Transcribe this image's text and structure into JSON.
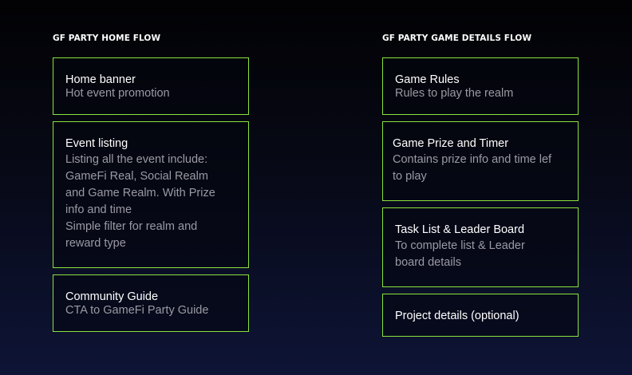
{
  "home_flow": {
    "title": "GF PARTY HOME FLOW",
    "cards": [
      {
        "title": "Home banner",
        "desc": "Hot event promotion"
      },
      {
        "title": "Event listing",
        "desc": "Listing all the event include:\nGameFi Real, Social Realm\nand Game Realm. With Prize\ninfo and time\nSimple filter for realm and\nreward type"
      },
      {
        "title": "Community Guide",
        "desc": "CTA to GameFi Party Guide"
      }
    ]
  },
  "game_details_flow": {
    "title": "GF PARTY GAME DETAILS FLOW",
    "cards": [
      {
        "title": "Game Rules",
        "desc": "Rules to play the realm"
      },
      {
        "title": "Game Prize and Timer",
        "desc": "Contains prize info and time lef\nto play"
      },
      {
        "title": "Task List & Leader Board",
        "desc": "To complete list & Leader\nboard details"
      },
      {
        "title": "Project details (optional)"
      }
    ]
  },
  "colors": {
    "card_border": "#8be33c",
    "title_text": "#ffffff",
    "desc_text": "#9a9aa4"
  }
}
